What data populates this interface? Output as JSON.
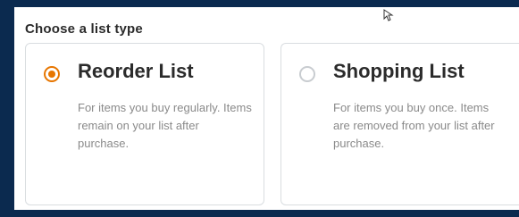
{
  "heading": "Choose a list type",
  "options": [
    {
      "title": "Reorder List",
      "description": "For items you buy regularly. Items remain on your list after purchase.",
      "selected": true
    },
    {
      "title": "Shopping List",
      "description": "For items you buy once. Items are removed from your list after purchase.",
      "selected": false
    }
  ],
  "colors": {
    "background": "#0b2a4f",
    "accent": "#e77600",
    "border": "#d9dde0",
    "text": "#2b2b2b",
    "muted": "#8a8a8a"
  },
  "icons": {
    "cursor": "mouse-cursor-icon",
    "radio_selected": "radio-selected-icon",
    "radio_unselected": "radio-unselected-icon"
  }
}
